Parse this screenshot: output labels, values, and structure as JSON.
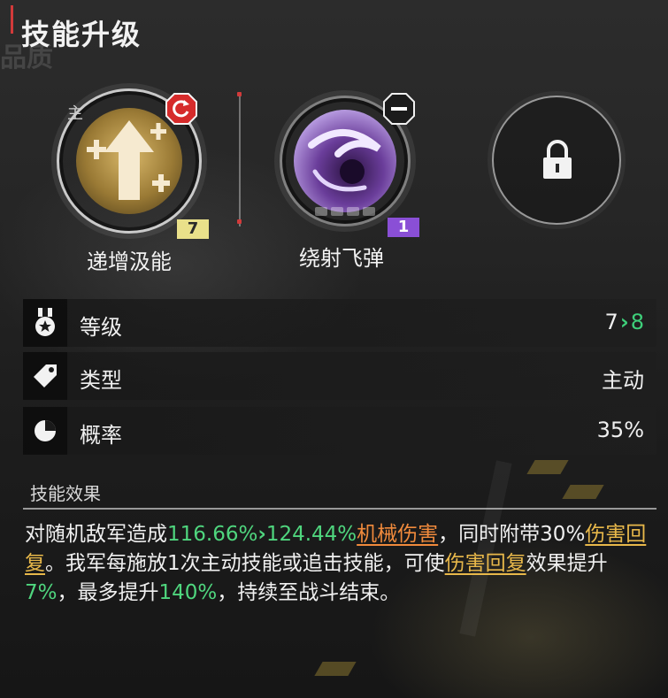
{
  "page": {
    "title": "技能升级",
    "ghost_text": "品质"
  },
  "skills": [
    {
      "name": "递增汲能",
      "level": "7",
      "tag": "主"
    },
    {
      "name": "绕射飞弹",
      "level": "1"
    },
    {
      "name": "",
      "locked": true
    }
  ],
  "info_rows": {
    "level": {
      "label": "等级",
      "from": "7",
      "arrow": "›",
      "to": "8",
      "icon": "medal-icon"
    },
    "type": {
      "label": "类型",
      "value": "主动",
      "icon": "tag-icon"
    },
    "chance": {
      "label": "概率",
      "value": "35%",
      "icon": "moon-icon"
    }
  },
  "effect": {
    "section_label": "技能效果",
    "parts": {
      "p1": "对随机敌军造成",
      "v_from": "116.66%",
      "arrow": "›",
      "v_to": "124.44%",
      "dmg_type": "机械伤害",
      "p2": "，同时附带30%",
      "heal1": "伤害回复",
      "p3": "。我军每施放1次主动技能或追击技能，可使",
      "heal2": "伤害回复",
      "p4": "效果提升",
      "inc": "7%",
      "p5": "，最多提升",
      "max": "140%",
      "p6": "，持续至战斗结束。"
    }
  },
  "colors": {
    "accent_red": "#d23a3a",
    "green": "#4fd67e",
    "orange": "#f08a3c",
    "gold": "#e8b84a",
    "level_badge_yellow": "#e9e08a",
    "level_badge_purple": "#8a4fd6"
  }
}
